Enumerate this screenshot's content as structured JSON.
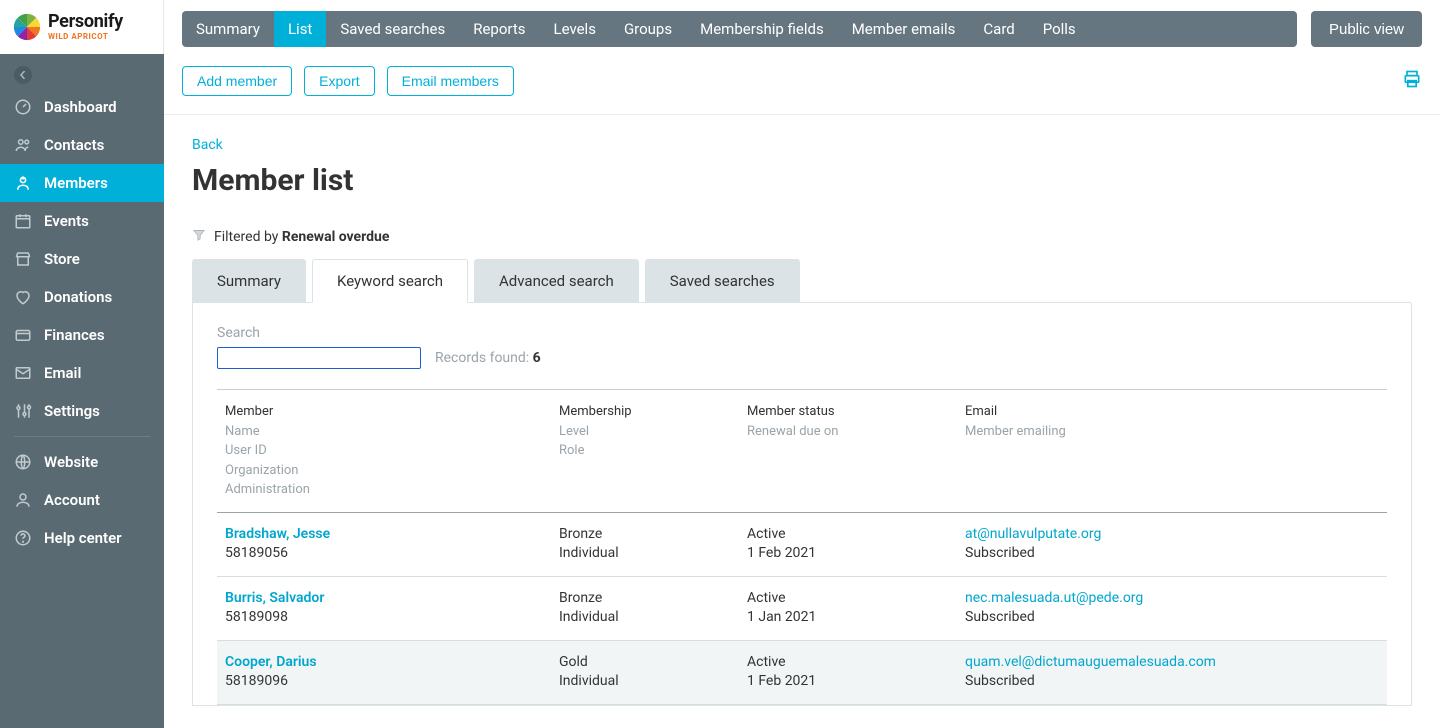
{
  "brand": {
    "primary": "Personify",
    "sub": "WILD APRICOT"
  },
  "sidebar": {
    "items": [
      {
        "label": "Dashboard",
        "icon": "dashboard"
      },
      {
        "label": "Contacts",
        "icon": "contacts"
      },
      {
        "label": "Members",
        "icon": "members",
        "active": true
      },
      {
        "label": "Events",
        "icon": "events"
      },
      {
        "label": "Store",
        "icon": "store"
      },
      {
        "label": "Donations",
        "icon": "donations"
      },
      {
        "label": "Finances",
        "icon": "finances"
      },
      {
        "label": "Email",
        "icon": "email"
      },
      {
        "label": "Settings",
        "icon": "settings"
      }
    ],
    "items2": [
      {
        "label": "Website",
        "icon": "website"
      },
      {
        "label": "Account",
        "icon": "account"
      },
      {
        "label": "Help center",
        "icon": "help"
      }
    ]
  },
  "tabs": [
    {
      "label": "Summary"
    },
    {
      "label": "List",
      "active": true
    },
    {
      "label": "Saved searches"
    },
    {
      "label": "Reports"
    },
    {
      "label": "Levels"
    },
    {
      "label": "Groups"
    },
    {
      "label": "Membership fields"
    },
    {
      "label": "Member emails"
    },
    {
      "label": "Card"
    },
    {
      "label": "Polls"
    }
  ],
  "public_view": "Public view",
  "actions": {
    "add": "Add member",
    "export": "Export",
    "email": "Email members"
  },
  "back": "Back",
  "page_title": "Member list",
  "filter": {
    "prefix": "Filtered by",
    "value": "Renewal overdue"
  },
  "subtabs": {
    "summary": "Summary",
    "keyword": "Keyword search",
    "advanced": "Advanced search",
    "saved": "Saved searches"
  },
  "search": {
    "label": "Search",
    "value": "",
    "records_label": "Records found:",
    "records_count": "6"
  },
  "columns": {
    "c1": [
      "Member",
      "Name",
      "User ID",
      "Organization",
      "Administration"
    ],
    "c2": [
      "Membership",
      "Level",
      "Role"
    ],
    "c3": [
      "Member status",
      "Renewal due on"
    ],
    "c4": [
      "Email",
      "Member emailing"
    ]
  },
  "rows": [
    {
      "name": "Bradshaw, Jesse",
      "userid": "58189056",
      "level": "Bronze",
      "role": "Individual",
      "status": "Active",
      "renewal": "1 Feb 2021",
      "email": "at@nullavulputate.org",
      "emailing": "Subscribed"
    },
    {
      "name": "Burris, Salvador",
      "userid": "58189098",
      "level": "Bronze",
      "role": "Individual",
      "status": "Active",
      "renewal": "1 Jan 2021",
      "email": "nec.malesuada.ut@pede.org",
      "emailing": "Subscribed"
    },
    {
      "name": "Cooper, Darius",
      "userid": "58189096",
      "level": "Gold",
      "role": "Individual",
      "status": "Active",
      "renewal": "1 Feb 2021",
      "email": "quam.vel@dictumauguemalesuada.com",
      "emailing": "Subscribed",
      "alt": true
    }
  ]
}
